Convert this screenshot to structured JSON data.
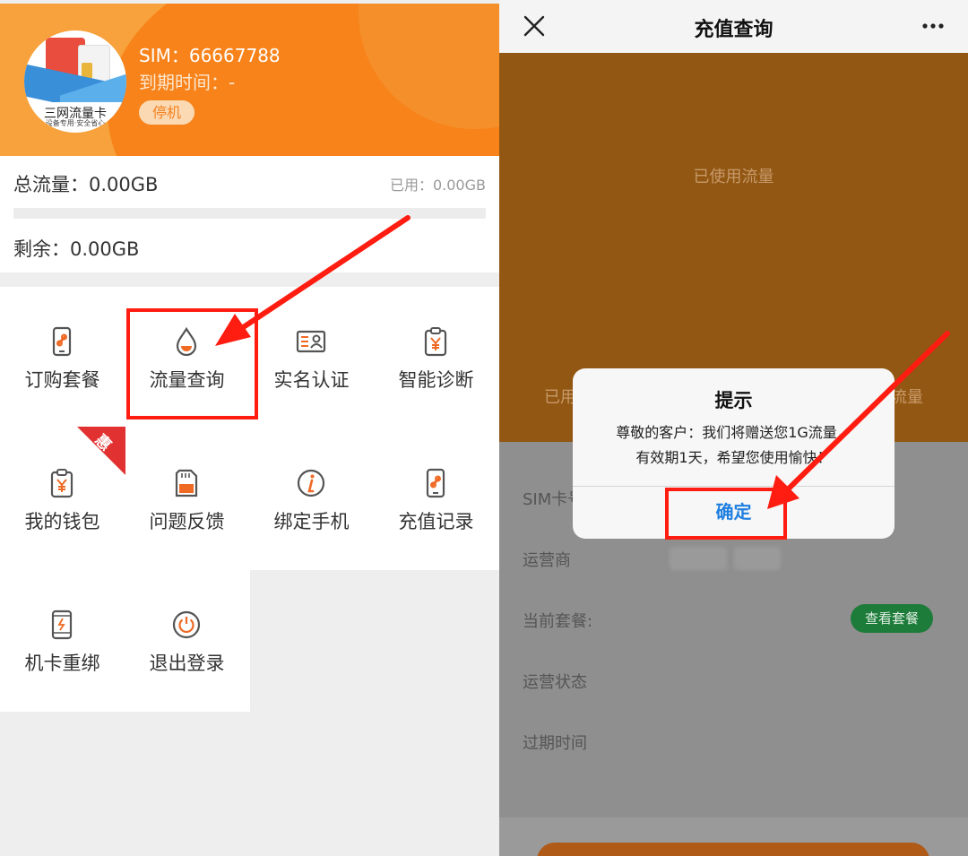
{
  "left_screen": {
    "logo": {
      "name": "三网流量卡",
      "slogan": "设备专用·安全省心"
    },
    "sim_label": "SIM：66667788",
    "expiry_label": "到期时间：-",
    "status": "停机",
    "usage": {
      "total": "总流量：0.00GB",
      "used": "已用：0.00GB",
      "remaining": "剩余：0.00GB",
      "progress_fraction": 0
    },
    "menu": [
      {
        "label": "订购套餐",
        "icon": "phone-link-icon"
      },
      {
        "label": "流量查询",
        "icon": "water-drop-icon"
      },
      {
        "label": "实名认证",
        "icon": "id-card-icon"
      },
      {
        "label": "智能诊断",
        "icon": "clipboard-yen-icon"
      },
      {
        "label": "我的钱包",
        "icon": "wallet-yen-icon"
      },
      {
        "label": "问题反馈",
        "icon": "sim-card-icon"
      },
      {
        "label": "绑定手机",
        "icon": "info-icon"
      },
      {
        "label": "充值记录",
        "icon": "phone-link-icon"
      },
      {
        "label": "机卡重绑",
        "icon": "phone-rebind-icon"
      },
      {
        "label": "退出登录",
        "icon": "power-icon"
      }
    ],
    "hot_badge": "惠"
  },
  "right_screen": {
    "nav": {
      "title": "充值查询",
      "close_icon": "close-icon",
      "more_icon": "more-icon"
    },
    "banner": {
      "used_title": "已使用流量",
      "left_partial": "已用",
      "right_partial": "流量"
    },
    "rows": {
      "sim": "SIM卡号",
      "operator": "运营商",
      "plan": "当前套餐:",
      "status": "运营状态",
      "expiry": "过期时间"
    },
    "plan_button": "查看套餐",
    "dialog": {
      "title": "提示",
      "line1": "尊敬的客户：我们将赠送您1G流量，",
      "line2": "有效期1天，希望您使用愉快！",
      "ok": "确定"
    }
  },
  "colors": {
    "orange": "#f88a1e",
    "highlight_red": "#ff1c10",
    "dialog_blue": "#1f7fe0",
    "plan_green": "#1e7c3a"
  }
}
